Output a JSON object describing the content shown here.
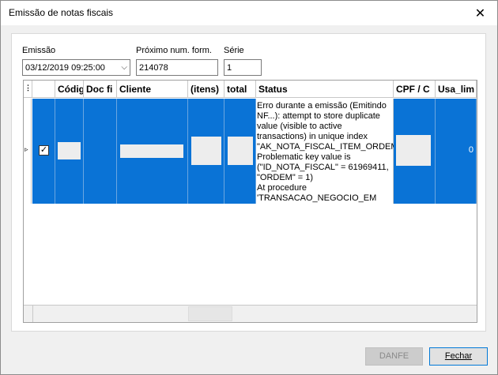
{
  "window": {
    "title": "Emissão de notas fiscais",
    "close_icon": "close-icon"
  },
  "form": {
    "emissao_label": "Emissão",
    "emissao_value": "03/12/2019 09:25:00",
    "proximo_label": "Próximo num. form.",
    "proximo_value": "214078",
    "serie_label": "Série",
    "serie_value": "1"
  },
  "grid": {
    "corner_icon": "select-all-icon",
    "columns": [
      "Códig",
      "Doc fi",
      "Cliente",
      "(itens)",
      "total",
      "Status",
      "CPF / C",
      "Usa_lim"
    ],
    "rows": [
      {
        "checked": true,
        "status": "Erro durante a emissão (Emitindo NF...): attempt to store duplicate value (visible to active transactions) in unique index \"AK_NOTA_FISCAL_ITEM_ORDEM\"\nProblematic key value is (\"ID_NOTA_FISCAL\" = 61969411, \"ORDEM\" = 1)\nAt procedure 'TRANSACAO_NEGOCIO_EM",
        "usa_lim": "0"
      }
    ]
  },
  "buttons": {
    "danfe": "DANFE",
    "fechar": "Fechar"
  },
  "colors": {
    "selection": "#0a73d6"
  }
}
